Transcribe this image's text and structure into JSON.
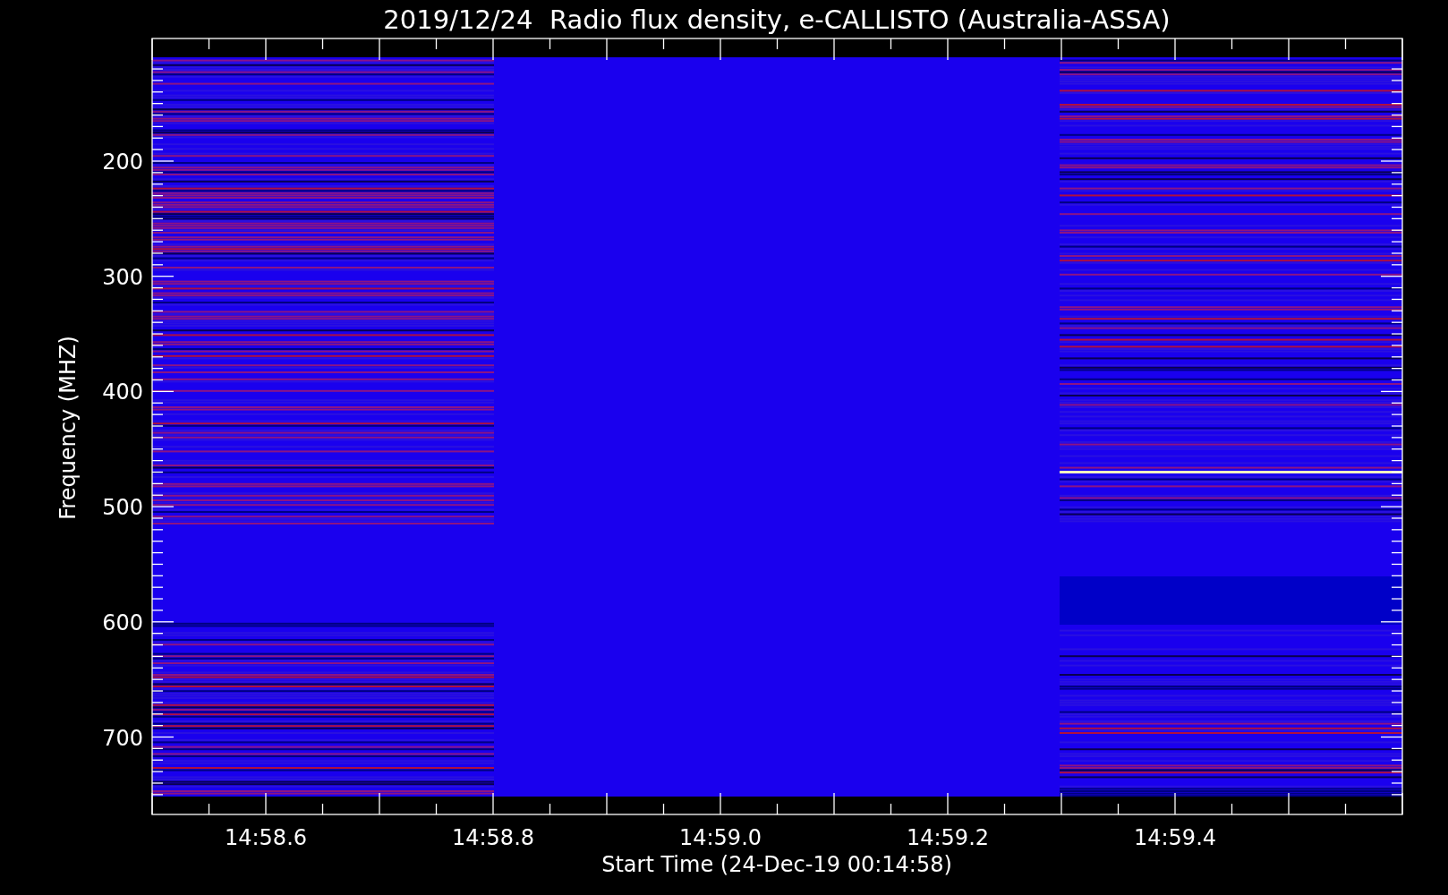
{
  "title": "2019/12/24  Radio flux density, e-CALLISTO (Australia-ASSA)",
  "y_axis": {
    "label": "Frequency (MHZ)",
    "tick_labels": [
      "200",
      "300",
      "400",
      "500",
      "600",
      "700"
    ]
  },
  "x_axis": {
    "label": "Start Time (24-Dec-19 00:14:58)",
    "tick_labels": [
      "14:58.6",
      "14:58.8",
      "14:59.0",
      "14:59.2",
      "14:59.4"
    ]
  }
}
